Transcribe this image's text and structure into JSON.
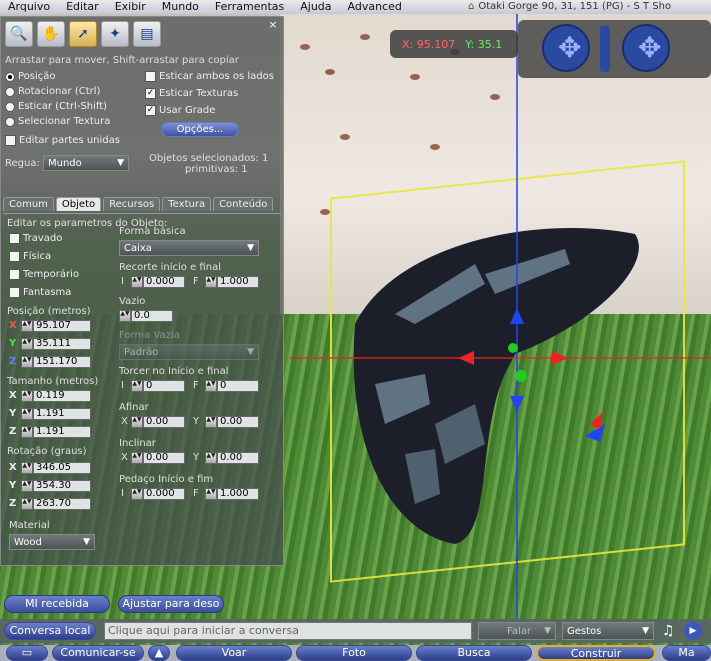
{
  "menu": [
    "Arquivo",
    "Editar",
    "Exibir",
    "Mundo",
    "Ferramentas",
    "Ajuda",
    "Advanced"
  ],
  "location": "Otaki Gorge 90, 31, 151 (PG) - S T Sho",
  "build": {
    "hint": "Arrastar para mover, Shift-arrastar para copiar",
    "modes": [
      "Posição",
      "Rotacionar (Ctrl)",
      "Esticar (Ctrl-Shift)",
      "Selecionar Textura"
    ],
    "edit_linked": "Editar partes unidas",
    "stretch_both": "Esticar ambos os lados",
    "stretch_textures": "Esticar Texturas",
    "use_grid": "Usar Grade",
    "options_btn": "Opções...",
    "ruler_label": "Regua:",
    "ruler_value": "Mundo",
    "selected": "Objetos selecionados: 1",
    "prims": "primitivas: 1",
    "tabs": [
      "Comum",
      "Objeto",
      "Recursos",
      "Textura",
      "Conteúdo"
    ],
    "close": "×"
  },
  "object": {
    "title": "Editar os parametros do Objeto:",
    "flags": [
      "Travado",
      "Física",
      "Temporário",
      "Fantasma"
    ],
    "position_label": "Posição (metros)",
    "position": {
      "x": "95.107",
      "y": "35.111",
      "z": "151.170"
    },
    "size_label": "Tamanho (metros)",
    "size": {
      "x": "0.119",
      "y": "1.191",
      "z": "1.191"
    },
    "rotation_label": "Rotação (graus)",
    "rotation": {
      "x": "346.05",
      "y": "354.30",
      "z": "263.70"
    },
    "material_label": "Material",
    "material": "Wood",
    "shape_label": "Forma básica",
    "shape": "Caixa",
    "cut_label": "Recorte início e final",
    "cut_b": "0.000",
    "cut_e": "1.000",
    "hollow_label": "Vazio",
    "hollow": "0.0",
    "hollow_shape_label": "Forma Vazia",
    "hollow_shape": "Padrão",
    "twist_label": "Torcer no Início e final",
    "twist_b": "0",
    "twist_e": "0",
    "taper_label": "Afinar",
    "taper_x": "0.00",
    "taper_y": "0.00",
    "shear_label": "Inclinar",
    "shear_x": "0.00",
    "shear_y": "0.00",
    "slice_label": "Pedaço Início e fim",
    "slice_b": "0.000",
    "slice_e": "1.000",
    "axis_x": "X",
    "axis_y": "Y",
    "axis_z": "Z",
    "begin_short": "I",
    "end_short": "F"
  },
  "coords": {
    "x": "X: 95.107",
    "y": "Y: 35.1"
  },
  "im_button": "MI recebida",
  "adjust_button": "Ajustar para deso",
  "chat": {
    "local_btn": "Conversa local",
    "placeholder": "Clique aqui para iniciar a conversa",
    "speak": "Falar",
    "gestures": "Gestos"
  },
  "toolbar": {
    "communicate": "Comunicar-se",
    "fly": "Voar",
    "snapshot": "Foto",
    "search": "Busca",
    "build": "Construir",
    "map": "Ma"
  }
}
